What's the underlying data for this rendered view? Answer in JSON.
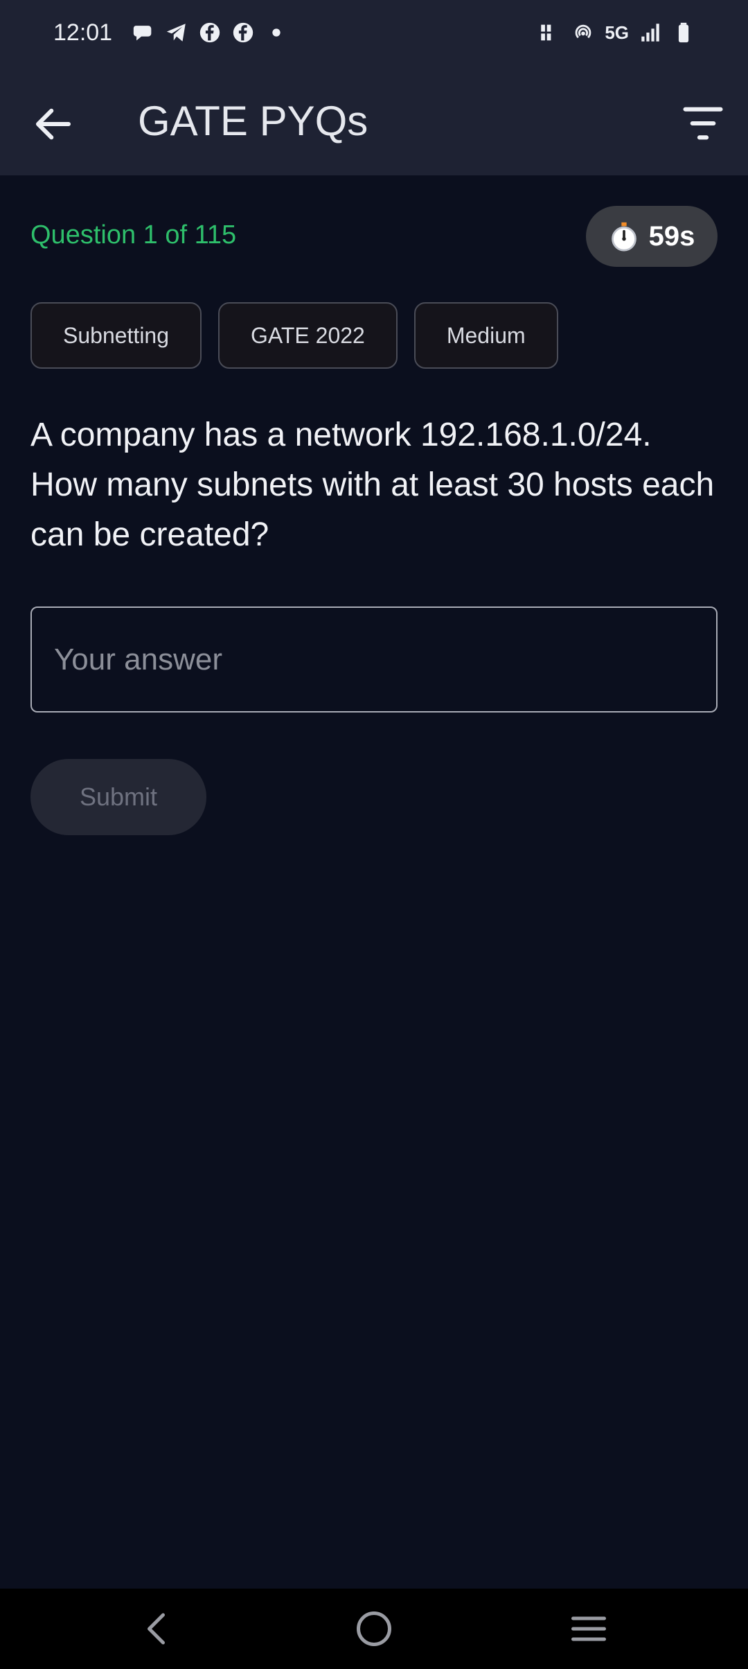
{
  "status_bar": {
    "time": "12:01",
    "network": "5G",
    "left_icons": [
      "chat-icon",
      "telegram-icon",
      "facebook-icon",
      "facebook-icon",
      "dot-icon"
    ],
    "right_icons": [
      "volte-icon",
      "hotspot-icon",
      "signal-icon",
      "battery-icon"
    ]
  },
  "app_bar": {
    "title": "GATE PYQs",
    "back_icon": "arrow-left-icon",
    "filter_icon": "filter-icon"
  },
  "question": {
    "counter": "Question 1 of 115",
    "timer": "59s",
    "timer_icon": "stopwatch-icon",
    "tags": [
      "Subnetting",
      "GATE 2022",
      "Medium"
    ],
    "text": "A company has a network 192.168.1.0/24. How many subnets with at least 30 hosts each can be created?",
    "answer_value": "",
    "answer_placeholder": "Your answer",
    "submit_label": "Submit"
  },
  "colors": {
    "background": "#0b0f1e",
    "header": "#1e2233",
    "accent_green": "#2ebf6b",
    "chip_border": "#4a4c57"
  },
  "nav_bar": {
    "icons": [
      "nav-back-icon",
      "nav-home-icon",
      "nav-recents-icon"
    ]
  }
}
